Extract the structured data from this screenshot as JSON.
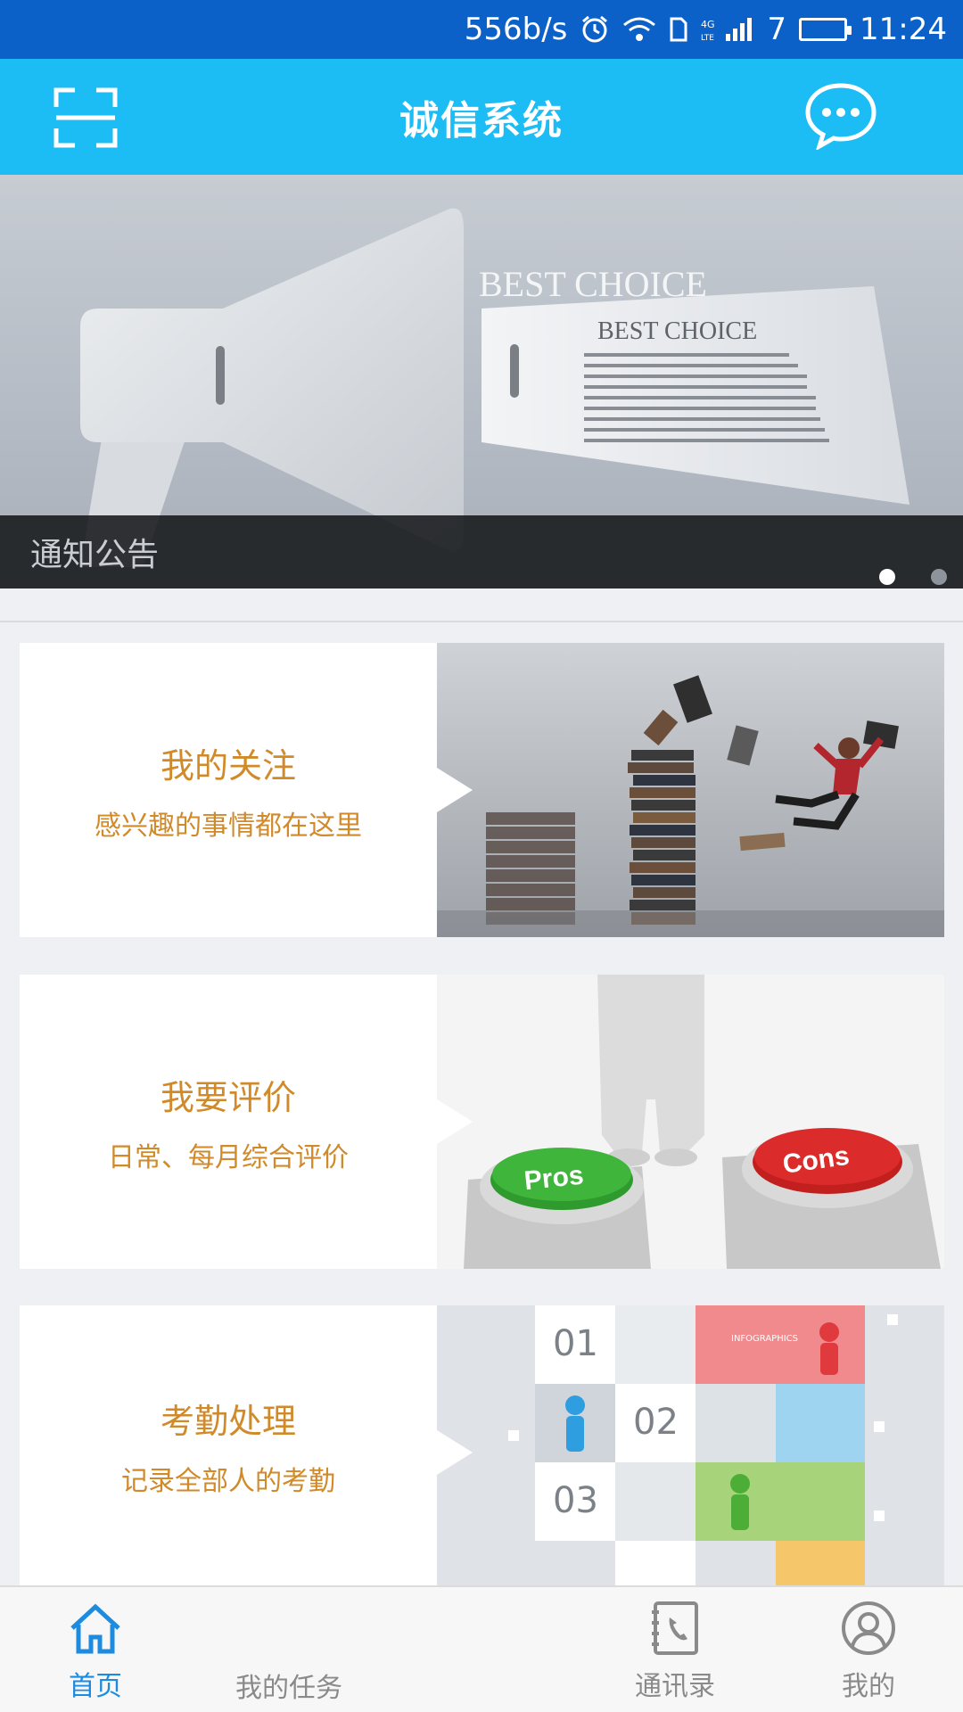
{
  "status_bar": {
    "speed": "556b/s",
    "network": "4G",
    "battery": "7",
    "time": "11:24"
  },
  "header": {
    "title": "诚信系统",
    "scan_icon": "scan-icon",
    "message_icon": "chat-bubble-icon"
  },
  "banner": {
    "caption": "通知公告",
    "headline_large": "BEST CHOICE",
    "headline_small": "BEST CHOICE",
    "slide_count": 2,
    "active_slide": 1
  },
  "cards": [
    {
      "title": "我的关注",
      "subtitle": "感兴趣的事情都在这里"
    },
    {
      "title": "我要评价",
      "subtitle": "日常、每月综合评价",
      "image_text": {
        "green_button": "Pros",
        "red_button": "Cons"
      }
    },
    {
      "title": "考勤处理",
      "subtitle": "记录全部人的考勤",
      "image_text": {
        "n1": "01",
        "n2": "02",
        "n3": "03",
        "label": "INFOGRAPHICS"
      }
    }
  ],
  "bottom_nav": [
    {
      "label": "首页",
      "icon": "home-icon",
      "active": true
    },
    {
      "label": "我的任务",
      "icon": "",
      "active": false
    },
    {
      "label": "通讯录",
      "icon": "contacts-book-icon",
      "active": false
    },
    {
      "label": "我的",
      "icon": "profile-icon",
      "active": false
    }
  ],
  "colors": {
    "status_bar": "#0b61c8",
    "header": "#1cbcf5",
    "card_text": "#d08a2a",
    "nav_active": "#1c8be0"
  }
}
